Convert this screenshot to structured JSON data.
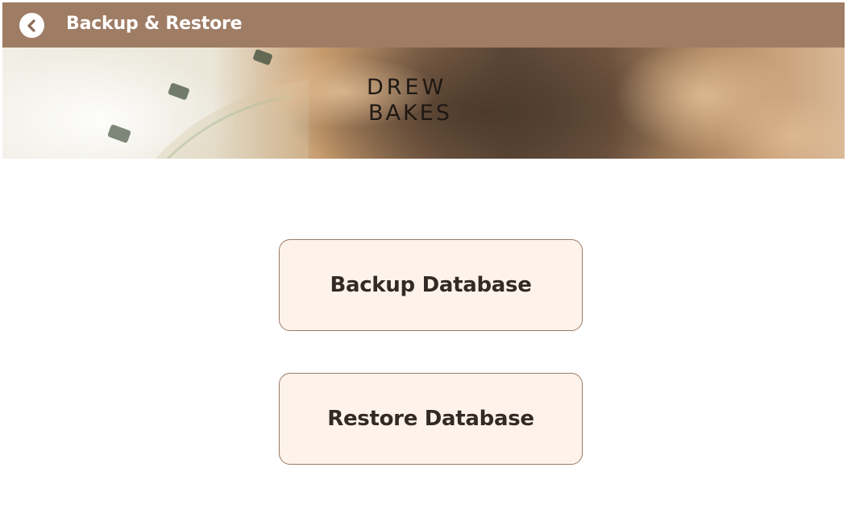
{
  "window": {
    "title": "Backup & Restore"
  },
  "header": {
    "back_icon": "chevron-left-icon",
    "bar_color": "#9f7c64"
  },
  "banner": {
    "logo_line1": "DREW",
    "logo_line2": "BAKES"
  },
  "main": {
    "backup_button_label": "Backup Database",
    "restore_button_label": "Restore Database",
    "button_fill": "#fef3ea",
    "button_border": "#9a7a66"
  }
}
